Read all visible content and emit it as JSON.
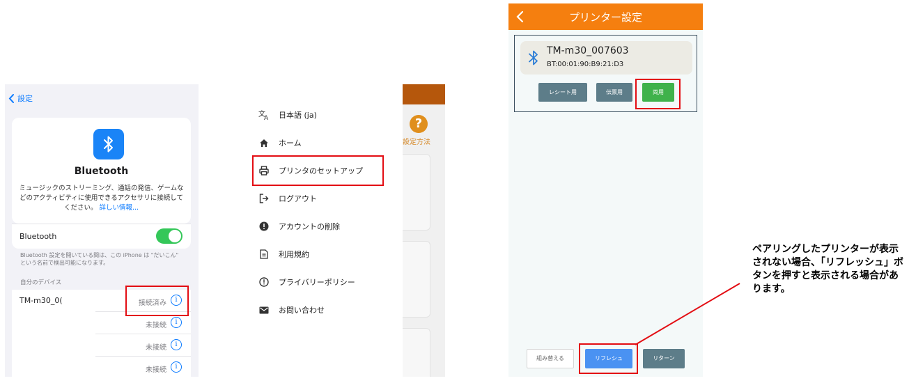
{
  "ios": {
    "back_label": "設定",
    "title": "Bluetooth",
    "description": "ミュージックのストリーミング、通話の発信、ゲームなどのアクティビティに使用できるアクセサリに接続してください。",
    "more_link": "詳しい情報...",
    "toggle_label": "Bluetooth",
    "toggle_on": true,
    "note": "Bluetooth 設定を開いている間は、この iPhone は \"だいこん\" という名前で検出可能になります。",
    "section_header": "自分のデバイス",
    "devices": [
      {
        "name": "TM-m30_0(",
        "status": "接続済み",
        "info": "i"
      },
      {
        "name": "",
        "status": "未接続",
        "info": "i"
      },
      {
        "name": "",
        "status": "未接続",
        "info": "i"
      },
      {
        "name": "",
        "status": "未接続",
        "info": "i"
      }
    ]
  },
  "menu": {
    "items": [
      {
        "icon": "translate-icon",
        "label": "日本語 (ja)"
      },
      {
        "icon": "home-icon",
        "label": "ホーム"
      },
      {
        "icon": "printer-icon",
        "label": "プリンタのセットアップ"
      },
      {
        "icon": "logout-icon",
        "label": "ログアウト"
      },
      {
        "icon": "alert-icon",
        "label": "アカウントの削除"
      },
      {
        "icon": "document-icon",
        "label": "利用規約"
      },
      {
        "icon": "info-icon",
        "label": "プライバリーポリシー"
      },
      {
        "icon": "mail-icon",
        "label": "お問い合わせ"
      }
    ],
    "background_app": {
      "help_label": "設定方法",
      "help_glyph": "?"
    }
  },
  "printer": {
    "title": "プリンター設定",
    "device_name": "TM-m30_007603",
    "device_address": "BT:00:01:90:B9:21:D3",
    "buttons": {
      "receipt": "レシート用",
      "slip": "伝票用",
      "both": "両用"
    },
    "footer": {
      "rearrange": "組み替える",
      "refresh": "リフレシュ",
      "return": "リターン"
    }
  },
  "annotation": {
    "text": "ペアリングしたプリンターが表示されない場合、「リフレッシュ」ボタンを押すと表示される場合があります。"
  },
  "colors": {
    "highlight": "#e30d13",
    "ios_blue": "#0a7aff",
    "ios_green": "#34c759",
    "header_orange": "#f57f0f",
    "button_gray": "#5d7d89",
    "button_green": "#3fb24b",
    "button_blue": "#4a92f2"
  }
}
